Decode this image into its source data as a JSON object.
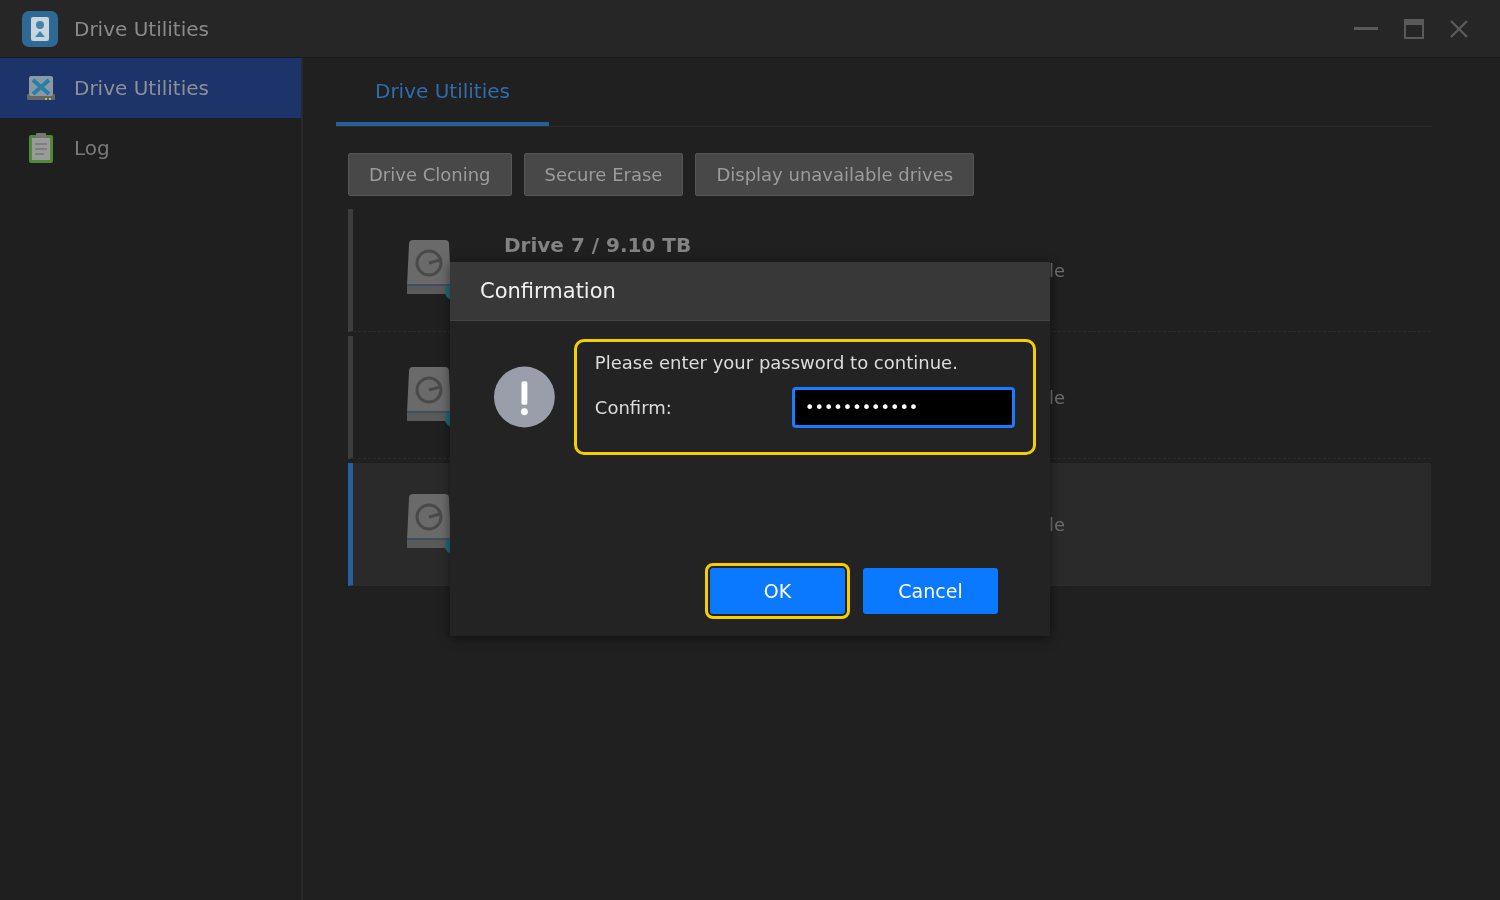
{
  "window": {
    "title": "Drive Utilities"
  },
  "sidebar": {
    "items": [
      {
        "label": "Drive Utilities",
        "kind": "tools",
        "selected": true
      },
      {
        "label": "Log",
        "kind": "log",
        "selected": false
      }
    ]
  },
  "tabs": [
    {
      "label": "Drive Utilities",
      "selected": true
    }
  ],
  "toolbar": [
    "Drive Cloning",
    "Secure Erase",
    "Display unavailable drives"
  ],
  "drives": [
    {
      "name": "Drive 7 / 9.10 TB",
      "status": "le",
      "selected": false
    },
    {
      "status": "le",
      "selected": false
    },
    {
      "status": "le",
      "selected": true
    }
  ],
  "dialog": {
    "title": "Confirmation",
    "message": "Please enter your password to continue.",
    "highlighted": true,
    "field": {
      "label": "Confirm:",
      "value": "••••••••••••"
    },
    "buttons": [
      {
        "label": "OK",
        "highlighted": true
      },
      {
        "label": "Cancel",
        "highlighted": false
      }
    ]
  }
}
